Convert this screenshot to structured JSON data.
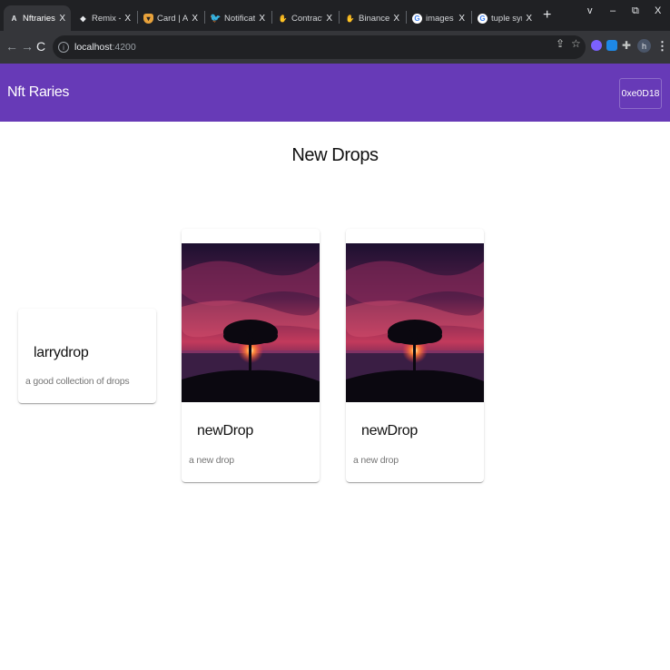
{
  "browser": {
    "tabs": [
      {
        "title": "Nftraries",
        "icon": "angular-icon",
        "active": true
      },
      {
        "title": "Remix - Ether",
        "icon": "remix-icon"
      },
      {
        "title": "Card | Angular",
        "icon": "shield-icon"
      },
      {
        "title": "Notifications",
        "icon": "twitter-icon"
      },
      {
        "title": "Contract Add",
        "icon": "hand-icon"
      },
      {
        "title": "Binance Trans",
        "icon": "hand-icon"
      },
      {
        "title": "images - Goo",
        "icon": "google-icon"
      },
      {
        "title": "tuple syntax",
        "icon": "google-icon"
      }
    ],
    "tab_close": "X",
    "new_tab": "+",
    "window_controls": {
      "dropdown": "v",
      "minimize": "–",
      "restore": "⧉",
      "close": "X"
    },
    "url_host": "localhost",
    "url_port": ":4200",
    "profile_initial": "h"
  },
  "app": {
    "brand": "Nft Raries",
    "wallet_button": "0xe0D18",
    "accent_color": "#673ab7"
  },
  "page": {
    "title": "New Drops",
    "collection": {
      "title": "larrydrop",
      "subtitle": "a good collection of drops"
    },
    "drops": [
      {
        "title": "newDrop",
        "subtitle": "a new drop",
        "image": "sunset-tree-image"
      },
      {
        "title": "newDrop",
        "subtitle": "a new drop",
        "image": "sunset-tree-image"
      }
    ]
  }
}
